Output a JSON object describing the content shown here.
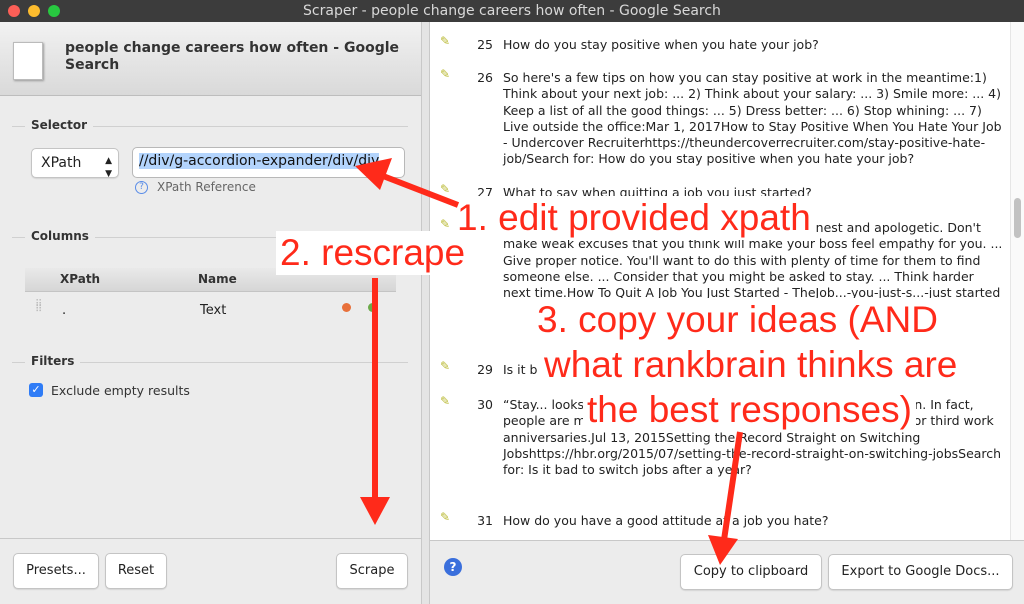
{
  "window": {
    "title": "Scraper - people change careers how often - Google Search"
  },
  "left": {
    "page_title": "people change careers how often - Google Search",
    "selector": {
      "section": "Selector",
      "type": "XPath",
      "value": "//div/g-accordion-expander/div/div",
      "reference": "XPath Reference"
    },
    "columns": {
      "section": "Columns",
      "headers": [
        "XPath",
        "Name"
      ],
      "rows": [
        {
          "xpath": ".",
          "name": "Text"
        }
      ]
    },
    "filters": {
      "section": "Filters",
      "exclude_empty": {
        "label": "Exclude empty results",
        "checked": true
      }
    },
    "buttons": {
      "presets": "Presets...",
      "reset": "Reset",
      "scrape": "Scrape"
    }
  },
  "results": [
    {
      "n": "25",
      "text": "How do you stay positive when you hate your job?"
    },
    {
      "n": "26",
      "text": "So here's a few tips on how you can stay positive at work in the meantime:1) Think about your next job: ... 2) Think about your salary: ... 3) Smile more: ... 4) Keep a list of all the good things: ... 5) Dress better: ... 6) Stop whining: ... 7) Live outside the office:Mar 1, 2017How to Stay Positive When You Hate Your Job - Undercover Recruiterhttps://theundercoverrecruiter.com/stay-positive-hate-job/Search for: How do you stay positive when you hate your job?"
    },
    {
      "n": "27",
      "text": "What to say when quitting a job you just started?"
    },
    {
      "n": "28",
      "text": "Leave gracefully. Don't burn any bridges. ... Be honest and apologetic. Don't make weak excuses that you think will make your boss feel empathy for you. ... Give proper notice. You'll want to do this with plenty of time for them to find someone else. ... Consider that you might be asked to stay. ... Think harder next time.How To Quit A Job You Just Started - TheJob...-you-just-s...-just started"
    },
    {
      "n": "29",
      "text": "Is it b"
    },
    {
      "n": "30",
      "text": "“Stay... looks bad o... thing. “It's become part of life,” says Sullivan. In fact, people are most likely to leave their jobs after their first, second, or third work anniversaries.Jul 13, 2015Setting the Record Straight on Switching Jobshttps://hbr.org/2015/07/setting-the-record-straight-on-switching-jobsSearch for: Is it bad to switch jobs after a year?"
    },
    {
      "n": "31",
      "text": "How do you have a good attitude at a job you hate?"
    }
  ],
  "right_buttons": {
    "copy": "Copy to clipboard",
    "export": "Export to Google Docs..."
  },
  "annotations": {
    "a1": "1. edit provided xpath",
    "a2": "2. rescrape",
    "a3_l1": "3. copy your ideas (AND",
    "a3_l2": "what rankbrain thinks are",
    "a3_l3": "the best responses)"
  },
  "colors": {
    "annotation": "#ff2a1a",
    "selection": "#b3d4fc",
    "checkbox": "#2f7cf6"
  }
}
